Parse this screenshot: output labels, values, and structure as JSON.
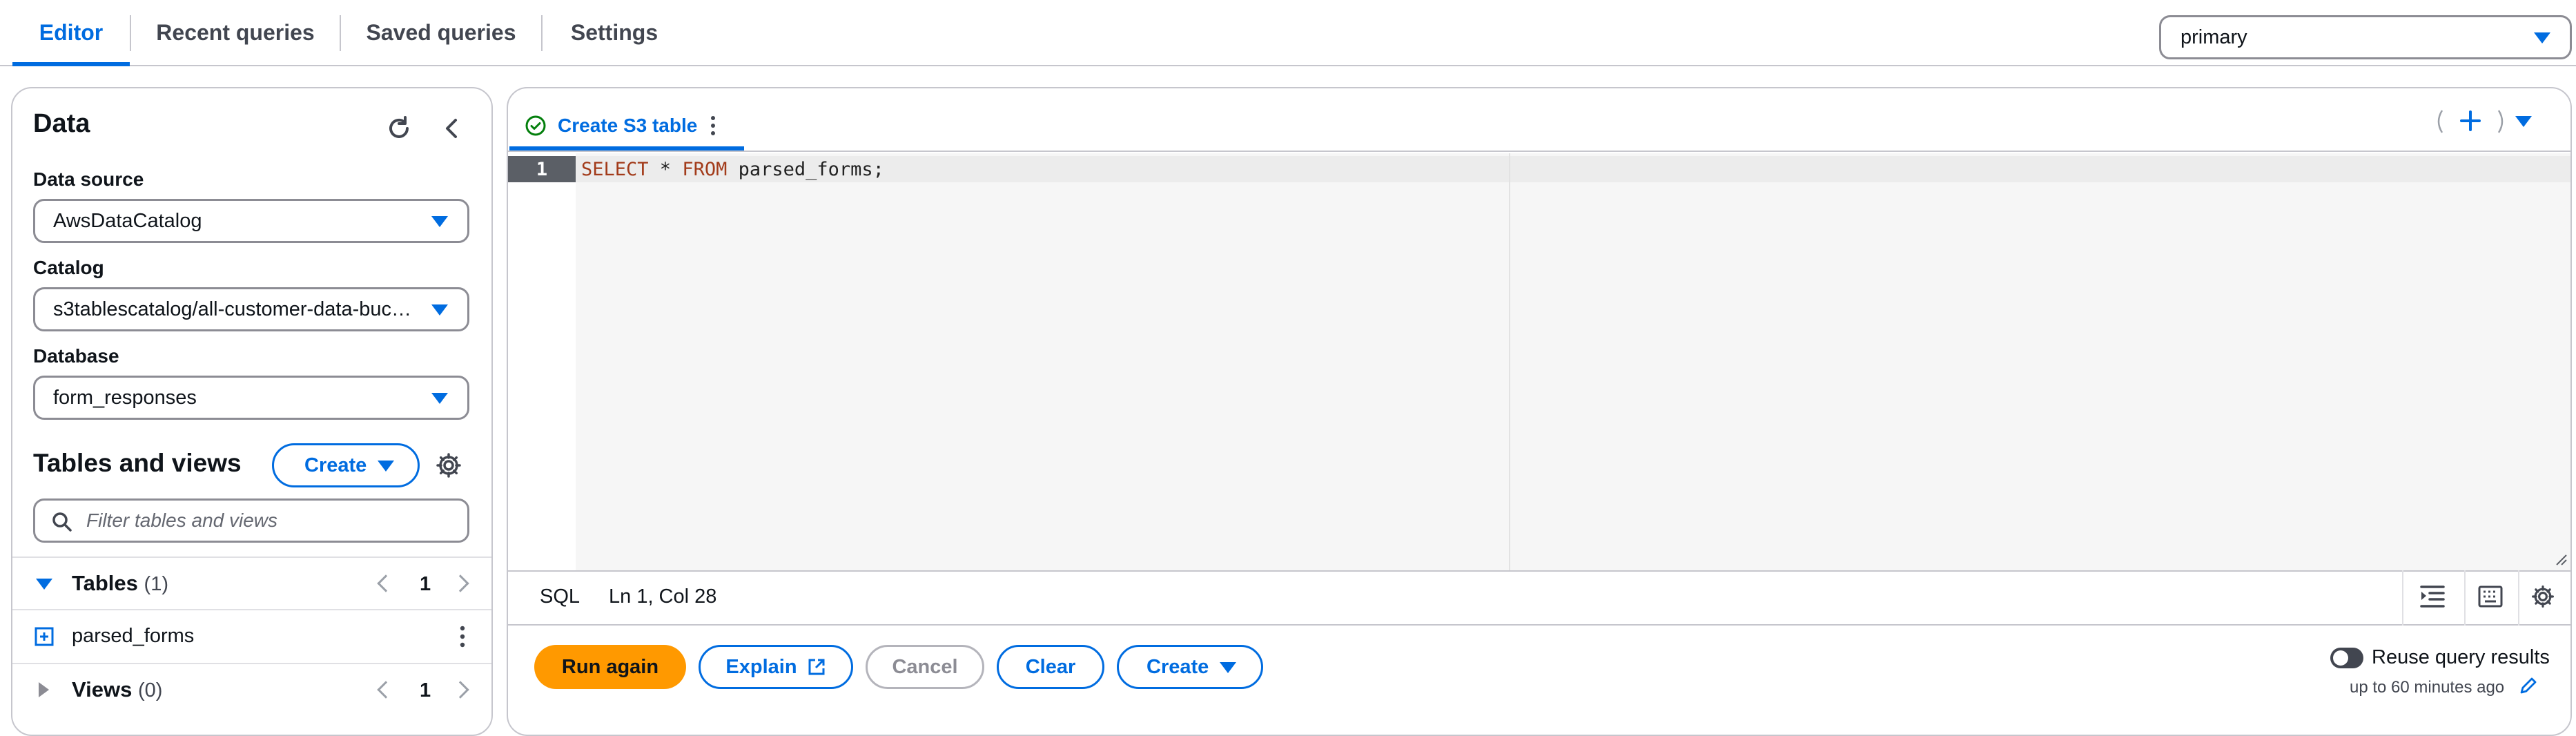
{
  "top_tabs": [
    {
      "label": "Editor",
      "active": true
    },
    {
      "label": "Recent queries",
      "active": false
    },
    {
      "label": "Saved queries",
      "active": false
    },
    {
      "label": "Settings",
      "active": false
    }
  ],
  "workgroup": {
    "value": "primary"
  },
  "left_panel": {
    "title": "Data",
    "data_source": {
      "label": "Data source",
      "value": "AwsDataCatalog"
    },
    "catalog": {
      "label": "Catalog",
      "value": "s3tablescatalog/all-customer-data-buc…"
    },
    "database": {
      "label": "Database",
      "value": "form_responses"
    },
    "tables_and_views": {
      "title": "Tables and views",
      "create_label": "Create",
      "filter_placeholder": "Filter tables and views"
    },
    "tables": {
      "label": "Tables",
      "count": "(1)",
      "page": "1",
      "items": [
        {
          "name": "parsed_forms"
        }
      ]
    },
    "views": {
      "label": "Views",
      "count": "(0)",
      "page": "1"
    }
  },
  "editor": {
    "query_tab": {
      "label": "Create S3 table"
    },
    "line_number": "1",
    "code": {
      "kw1": "SELECT",
      "star": " * ",
      "kw2": "FROM",
      "rest": " parsed_forms;"
    },
    "status": {
      "language": "SQL",
      "cursor": "Ln 1, Col 28"
    }
  },
  "actions": {
    "run_again": "Run again",
    "explain": "Explain",
    "cancel": "Cancel",
    "clear": "Clear",
    "create": "Create"
  },
  "reuse_results": {
    "label": "Reuse query results",
    "sub": "up to 60 minutes ago",
    "enabled": false
  },
  "colors": {
    "accent": "#006ce0",
    "primary_button": "#ff9900",
    "success": "#037f0c"
  }
}
